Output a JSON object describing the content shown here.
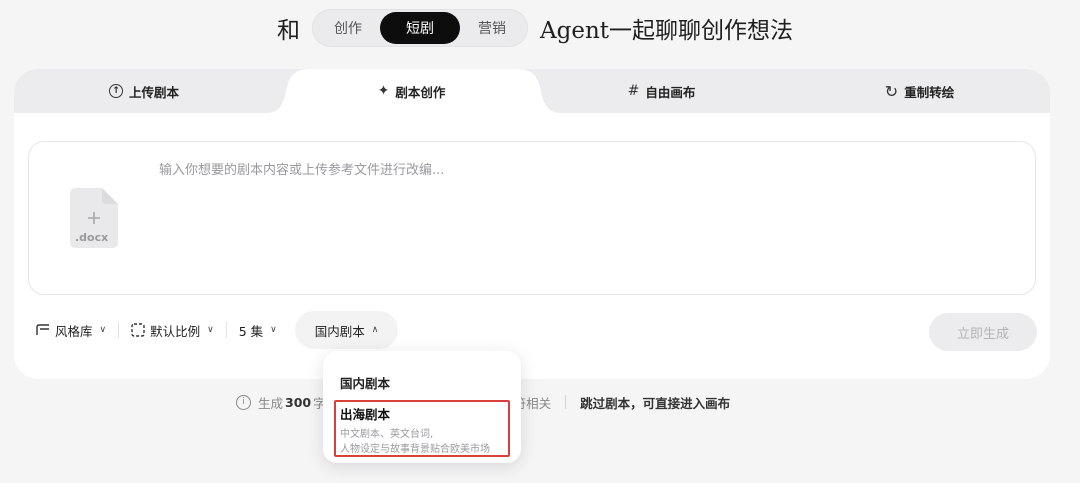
{
  "header": {
    "prefix": "和",
    "suffix": "Agent一起聊聊创作想法",
    "segments": [
      {
        "label": "创作",
        "active": false
      },
      {
        "label": "短剧",
        "active": true
      },
      {
        "label": "营销",
        "active": false
      }
    ]
  },
  "tabs": [
    {
      "label": "上传剧本",
      "icon": "upload-icon"
    },
    {
      "label": "剧本创作",
      "icon": "sparkle-icon",
      "active": true
    },
    {
      "label": "自由画布",
      "icon": "hash-icon"
    },
    {
      "label": "重制转绘",
      "icon": "refresh-icon"
    }
  ],
  "editor": {
    "placeholder": "输入你想要的剧本内容或上传参考文件进行改编...",
    "file_icon_label": ".docx"
  },
  "toolbar": {
    "style_library": "风格库",
    "aspect_ratio": "默认比例",
    "episodes": "5 集",
    "script_region": "国内剧本",
    "submit": "立即生成"
  },
  "hint": {
    "prefix": "生成",
    "amount": "300",
    "unit_fragment": "字",
    "tail": "输出的剧本字符相关",
    "skip": "跳过剧本，可直接进入画布"
  },
  "dropdown": {
    "option1": "国内剧本",
    "option2_title": "出海剧本",
    "option2_desc_line1": "中文剧本、英文台词,",
    "option2_desc_line2": "人物设定与故事背景贴合欧美市场"
  },
  "colors": {
    "accent_dark": "#0d0d0d",
    "highlight_border": "#d9403a",
    "page_bg": "#f5f5f6"
  }
}
